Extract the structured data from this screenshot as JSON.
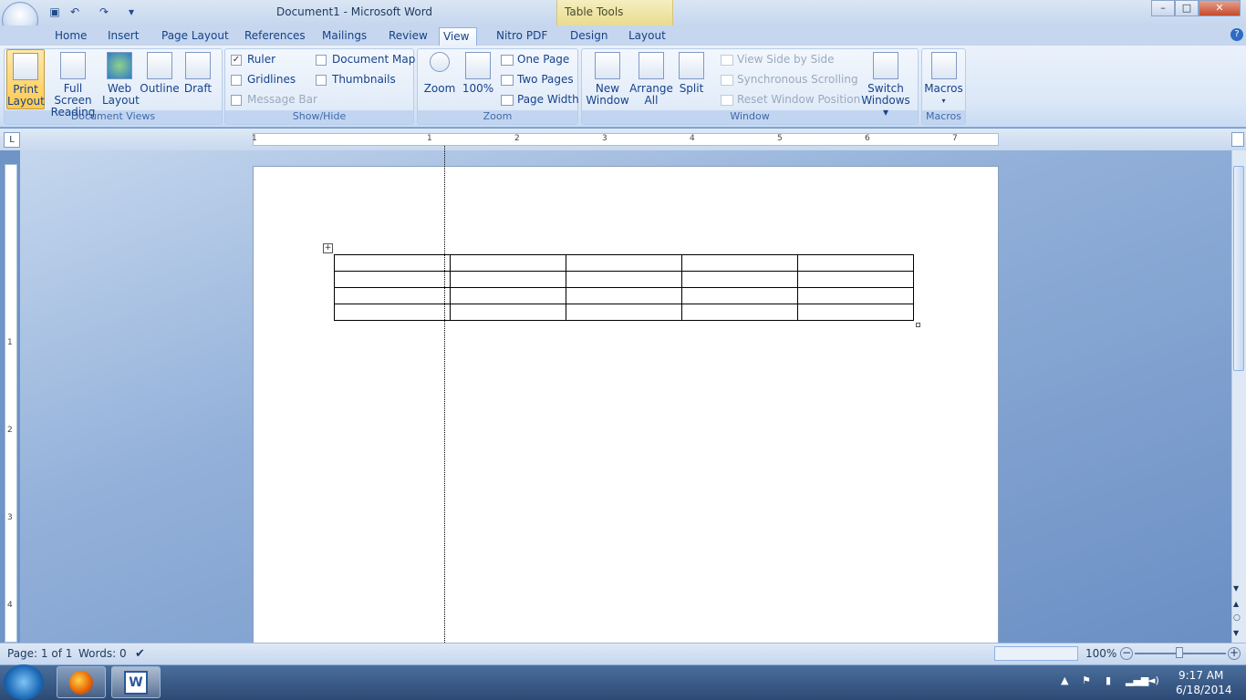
{
  "window": {
    "title": "Document1 - Microsoft Word",
    "contextual_tab": "Table Tools",
    "controls": {
      "minimize": "–",
      "maximize": "□",
      "close": "✕"
    }
  },
  "quick_access": {
    "save_icon": "floppy-disk",
    "undo_icon": "undo",
    "redo_icon": "redo"
  },
  "tabs": [
    {
      "label": "Home"
    },
    {
      "label": "Insert"
    },
    {
      "label": "Page Layout"
    },
    {
      "label": "References"
    },
    {
      "label": "Mailings"
    },
    {
      "label": "Review"
    },
    {
      "label": "View",
      "active": true
    },
    {
      "label": "Nitro PDF"
    },
    {
      "label": "Design"
    },
    {
      "label": "Layout"
    }
  ],
  "ribbon": {
    "document_views": {
      "label": "Document Views",
      "print_layout": [
        "Print",
        "Layout"
      ],
      "full_screen": [
        "Full Screen",
        "Reading"
      ],
      "web_layout": [
        "Web",
        "Layout"
      ],
      "outline": "Outline",
      "draft": "Draft"
    },
    "show_hide": {
      "label": "Show/Hide",
      "ruler": "Ruler",
      "gridlines": "Gridlines",
      "message_bar": "Message Bar",
      "document_map": "Document Map",
      "thumbnails": "Thumbnails",
      "ruler_checked": "✓"
    },
    "zoom": {
      "label": "Zoom",
      "zoom": "Zoom",
      "hundred": "100%",
      "one_page": "One Page",
      "two_pages": "Two Pages",
      "page_width": "Page Width"
    },
    "window": {
      "label": "Window",
      "new_window": [
        "New",
        "Window"
      ],
      "arrange_all": [
        "Arrange",
        "All"
      ],
      "split": "Split",
      "view_side_by_side": "View Side by Side",
      "sync_scrolling": "Synchronous Scrolling",
      "reset_position": "Reset Window Position",
      "switch_windows": [
        "Switch",
        "Windows ▾"
      ]
    },
    "macros": {
      "label": "Macros",
      "macros": "Macros"
    }
  },
  "ruler": {
    "h_numbers": [
      "1",
      "1",
      "2",
      "3",
      "4",
      "5",
      "6",
      "7"
    ],
    "v_numbers": [
      "1",
      "2",
      "3",
      "4"
    ]
  },
  "status": {
    "page": "Page: 1 of 1",
    "words": "Words: 0",
    "zoom": "100%"
  },
  "taskbar": {
    "time": "9:17 AM",
    "date": "6/18/2014"
  }
}
